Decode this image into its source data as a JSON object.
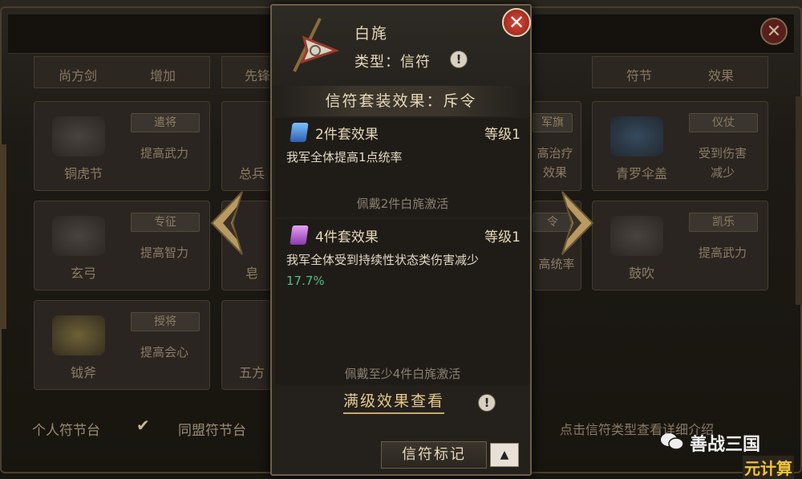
{
  "background": {
    "row_top": [
      "尚方剑",
      "增加",
      "先锋",
      "符节",
      "效果"
    ],
    "cards": [
      {
        "name": "铜虎节",
        "tag": "遣将",
        "effect": "提高武力"
      },
      {
        "name": "总兵",
        "tag": "",
        "effect": ""
      },
      {
        "name": "",
        "tag": "军旗",
        "effect": "高治疗\n效果"
      },
      {
        "name": "青罗伞盖",
        "tag": "仪仗",
        "effect": "受到伤害\n减少"
      },
      {
        "name": "玄弓",
        "tag": "专征",
        "effect": "提高智力"
      },
      {
        "name": "皂",
        "tag": "",
        "effect": ""
      },
      {
        "name": "",
        "tag": "令",
        "effect": "高统率"
      },
      {
        "name": "鼓吹",
        "tag": "凯乐",
        "effect": "提高武力"
      },
      {
        "name": "钺斧",
        "tag": "授将",
        "effect": "提高会心"
      },
      {
        "name": "五方",
        "tag": "",
        "effect": ""
      }
    ],
    "option_personal": "个人符节台",
    "option_alliance": "同盟符节台",
    "hint": "点击信符类型查看详细介绍",
    "watermark": "善战三国",
    "watermark2": "元计算"
  },
  "panel": {
    "title": "白旄",
    "type_label": "类型：信符",
    "set_effect_title": "信符套装效果：斥令",
    "sections": [
      {
        "title": "2件套效果",
        "level": "等级1",
        "desc": "我军全体提高1点统率",
        "desc_highlight": "",
        "activation": "佩戴2件白旄激活",
        "gem_color": "#3d7fd6"
      },
      {
        "title": "4件套效果",
        "level": "等级1",
        "desc": "我军全体受到持续性状态类伤害减少",
        "desc_highlight": "17.7%",
        "activation": "佩戴至少4件白旄激活",
        "gem_color": "#c45fd6"
      }
    ],
    "full_effect_button": "满级效果查看",
    "mark_button": "信符标记"
  }
}
